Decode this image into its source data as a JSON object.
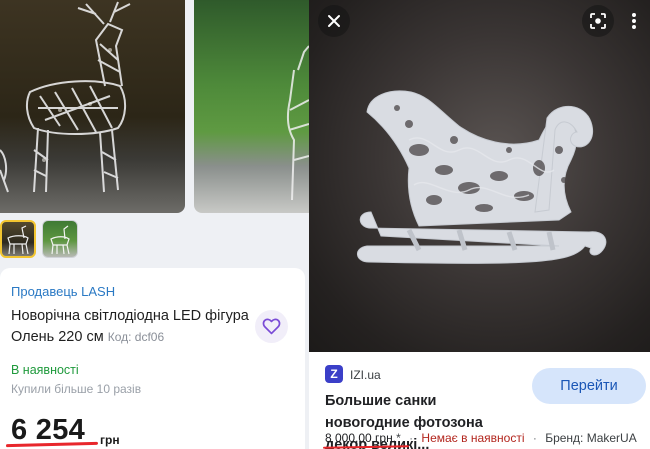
{
  "left_panel": {
    "seller": "Продавець LASH",
    "product_title": "Новорічна світлодіодна LED фігура Олень 220 см",
    "product_code": "Код: dcf06",
    "availability": "В наявності",
    "bought_info": "Купили більше 10 разів",
    "price": "6 254",
    "currency": "грн",
    "thumbnails": [
      "deer-photo-1",
      "deer-photo-2"
    ],
    "icons": {
      "favorite": "heart-icon"
    },
    "colors": {
      "seller_link": "#2a79c4",
      "availability": "#1f9a3c",
      "accent": "#7a4bd6",
      "underline": "#e8262b"
    }
  },
  "right_panel": {
    "source_logo_letter": "Z",
    "source_name": "IZI.ua",
    "go_button_label": "Перейти",
    "result_title": "Большие санки новогодние фотозона декор великі...",
    "price": "8 000,00 грн.",
    "price_note": "*",
    "stock_status": "Немає в наявності",
    "brand": "Бренд: MakerUA",
    "separator": "·",
    "icons": {
      "close": "close-icon",
      "lens": "lens-icon",
      "more": "more-vert-icon"
    },
    "colors": {
      "go_button_bg": "#d6e5fb",
      "go_button_text": "#1a56b6",
      "stock_status": "#b3261e",
      "source_logo": "#3b3fc8"
    }
  }
}
